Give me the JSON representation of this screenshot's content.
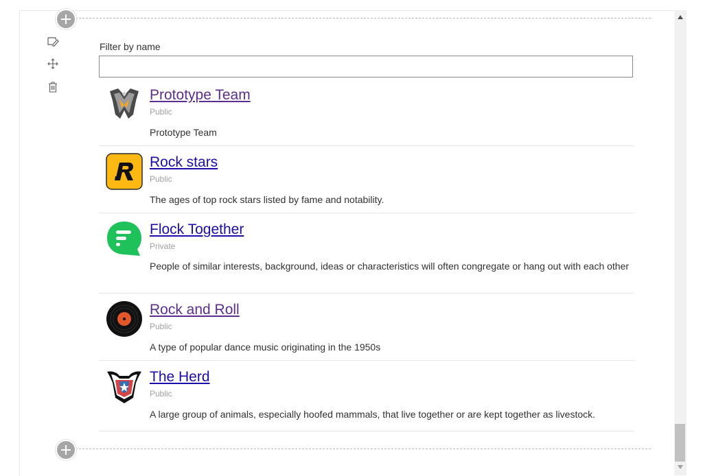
{
  "filter": {
    "label": "Filter by name",
    "value": "",
    "placeholder": ""
  },
  "toolbar": {
    "icons": [
      "edit-icon",
      "move-icon",
      "delete-icon"
    ]
  },
  "groups": [
    {
      "name": "Prototype Team",
      "privacy": "Public",
      "description": "Prototype Team",
      "logo": "prototype-logo-icon"
    },
    {
      "name": "Rock stars",
      "privacy": "Public",
      "description": "The ages of top rock stars listed by fame and notability.",
      "logo": "rockstar-logo-icon"
    },
    {
      "name": "Flock Together",
      "privacy": "Private",
      "description": "People of similar interests, background, ideas or characteristics will often congregate or hang out with each other",
      "logo": "flock-logo-icon"
    },
    {
      "name": "Rock and Roll",
      "privacy": "Public",
      "description": "A type of popular dance music originating in the 1950s",
      "logo": "vinyl-record-icon"
    },
    {
      "name": "The Herd",
      "privacy": "Public",
      "description": "A large group of animals, especially hoofed mammals, that live together or are kept together as livestock.",
      "logo": "herd-logo-icon"
    }
  ],
  "colors": {
    "link": "#1a0dab",
    "visited_link": "#5c2d91",
    "muted": "#a19f9d",
    "rockstar_yellow": "#fdb813",
    "flock_green": "#1fc25a"
  }
}
